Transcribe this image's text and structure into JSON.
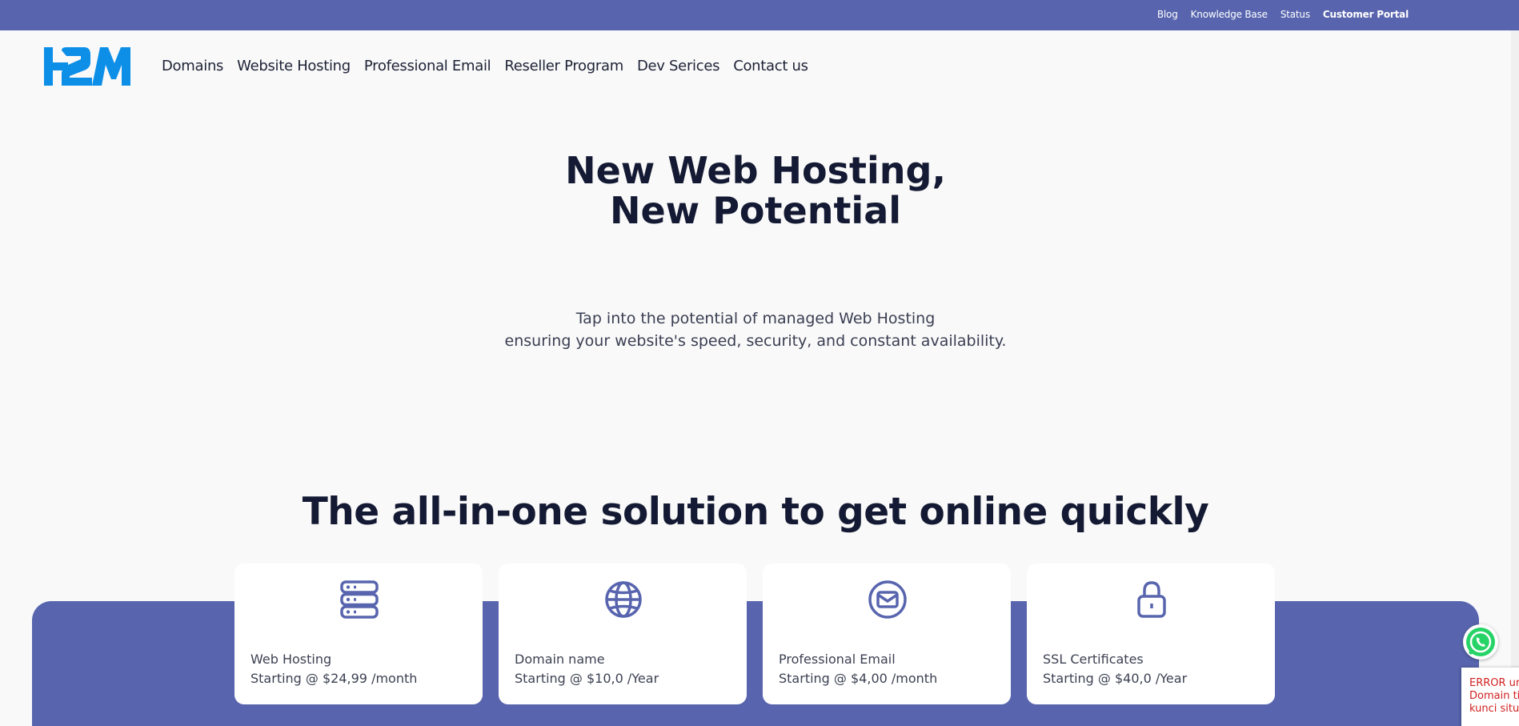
{
  "topbar": {
    "links": [
      "Blog",
      "Knowledge Base",
      "Status"
    ],
    "portal": "Customer Portal"
  },
  "brand": {
    "logo_text": "H2M",
    "color": "#0d8fe8"
  },
  "nav": [
    "Domains",
    "Website Hosting",
    "Professional Email",
    "Reseller Program",
    "Dev Serices",
    "Contact us"
  ],
  "hero": {
    "title_line1": "New Web Hosting,",
    "title_line2": "New Potential",
    "sub_line1": "Tap into the potential of managed Web Hosting",
    "sub_line2": "ensuring your website's speed, security, and constant availability."
  },
  "section": {
    "title": "The all-in-one solution to get online quickly"
  },
  "cards": [
    {
      "icon": "server-icon",
      "name": "Web Hosting",
      "price": "Starting @ $24,99 /month"
    },
    {
      "icon": "globe-icon",
      "name": "Domain name",
      "price": "Starting @ $10,0 /Year"
    },
    {
      "icon": "email-icon",
      "name": "Professional Email",
      "price": "Starting @ $4,00 /month"
    },
    {
      "icon": "lock-icon",
      "name": "SSL Certificates",
      "price": "Starting @ $40,0 /Year"
    }
  ],
  "widget": {
    "error_line1": "ERROR ur",
    "error_line2": "Domain ti",
    "error_line3": "kunci situ"
  },
  "colors": {
    "accent": "#5865ae",
    "heading": "#141a33",
    "whatsapp": "#25d366"
  }
}
